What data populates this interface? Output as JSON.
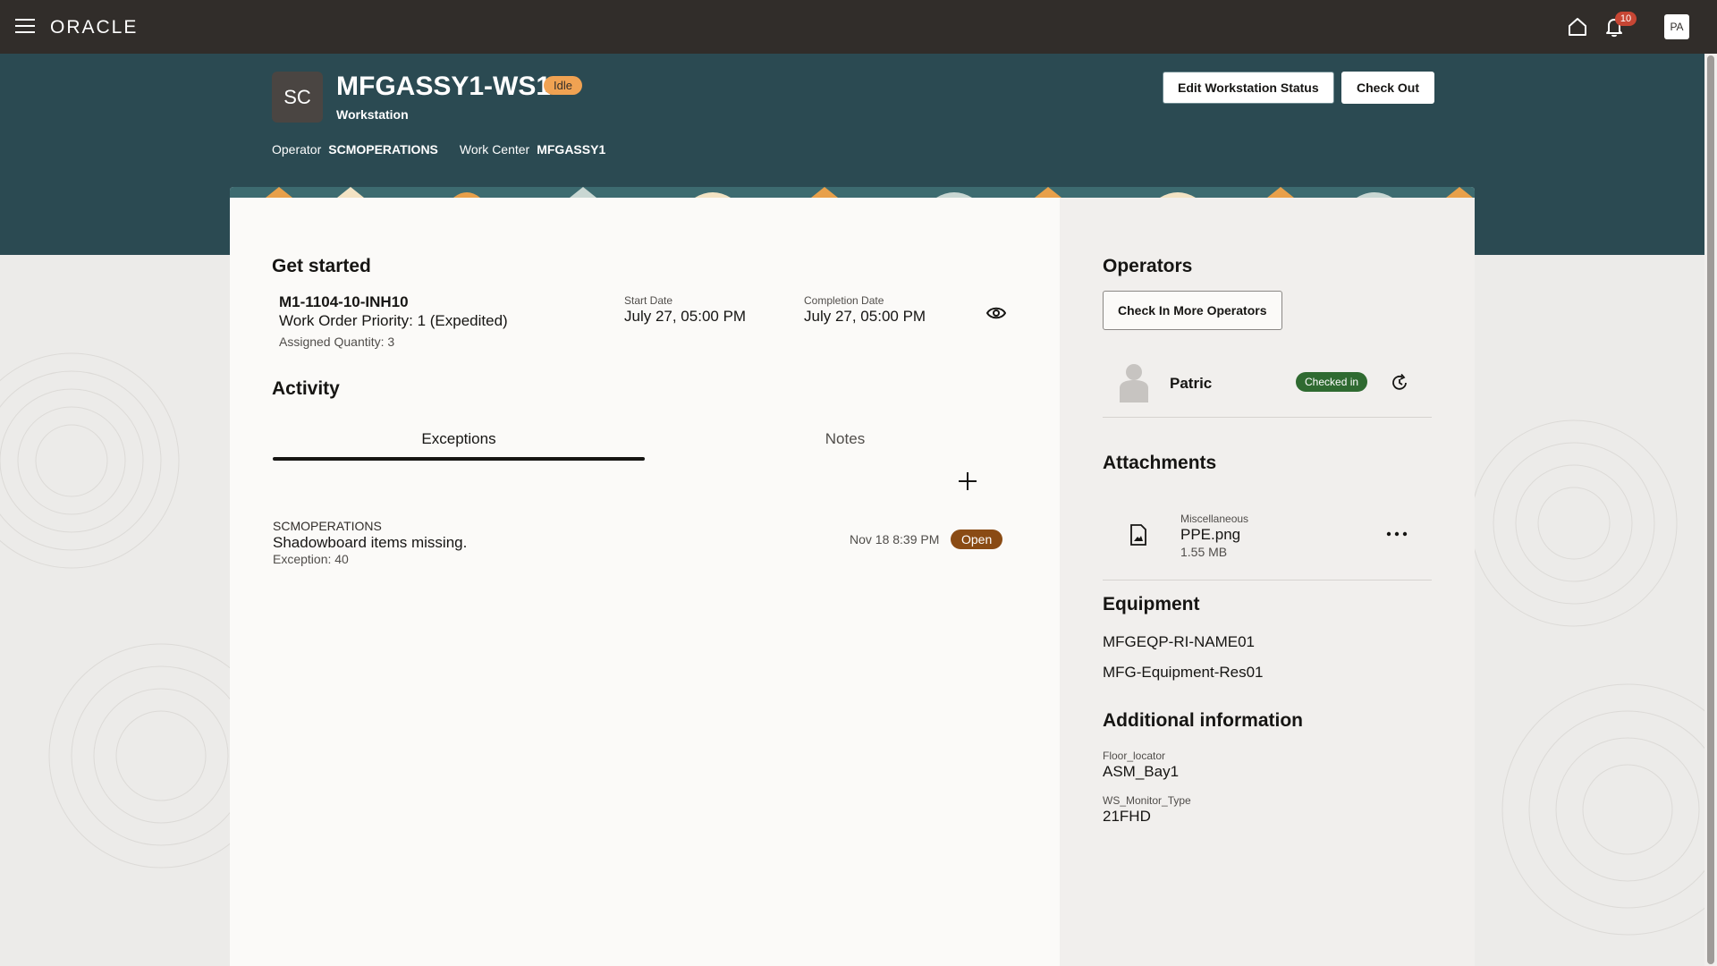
{
  "topbar": {
    "logo": "ORACLE",
    "notification_count": "10",
    "user_initials": "PA"
  },
  "workstation": {
    "initials": "SC",
    "title": "MFGASSY1-WS1",
    "status": "Idle",
    "subtitle": "Workstation",
    "operator_label": "Operator",
    "operator_value": "SCMOPERATIONS",
    "work_center_label": "Work Center",
    "work_center_value": "MFGASSY1",
    "edit_button": "Edit Workstation Status",
    "checkout_button": "Check Out"
  },
  "get_started": {
    "title": "Get started",
    "work_order": "M1-1104-10-INH10",
    "priority": "Work Order Priority: 1 (Expedited)",
    "assigned_qty": "Assigned Quantity: 3",
    "start_date_label": "Start Date",
    "start_date": "July 27, 05:00 PM",
    "completion_date_label": "Completion Date",
    "completion_date": "July 27, 05:00 PM"
  },
  "activity": {
    "title": "Activity",
    "tabs": [
      {
        "label": "Exceptions",
        "active": true
      },
      {
        "label": "Notes",
        "active": false
      }
    ],
    "exceptions": [
      {
        "user": "SCMOPERATIONS",
        "message": "Shadowboard items missing.",
        "number": "Exception: 40",
        "date": "Nov 18 8:39 PM",
        "status": "Open"
      }
    ]
  },
  "operators": {
    "title": "Operators",
    "checkin_button": "Check In More Operators",
    "list": [
      {
        "name": "Patric",
        "status": "Checked in"
      }
    ]
  },
  "attachments": {
    "title": "Attachments",
    "list": [
      {
        "category": "Miscellaneous",
        "name": "PPE.png",
        "size": "1.55 MB"
      }
    ]
  },
  "equipment": {
    "title": "Equipment",
    "items": [
      "MFGEQP-RI-NAME01",
      "MFG-Equipment-Res01"
    ]
  },
  "additional_info": {
    "title": "Additional information",
    "fields": [
      {
        "label": "Floor_locator",
        "value": "ASM_Bay1"
      },
      {
        "label": "WS_Monitor_Type",
        "value": "21FHD"
      }
    ]
  },
  "colors": {
    "topbar": "#312d2a",
    "header_band": "#2b4a52",
    "idle_badge": "#f0a252",
    "open_badge": "#8a4b14",
    "checked_in_badge": "#2f6a31",
    "notification_badge": "#c74634"
  }
}
